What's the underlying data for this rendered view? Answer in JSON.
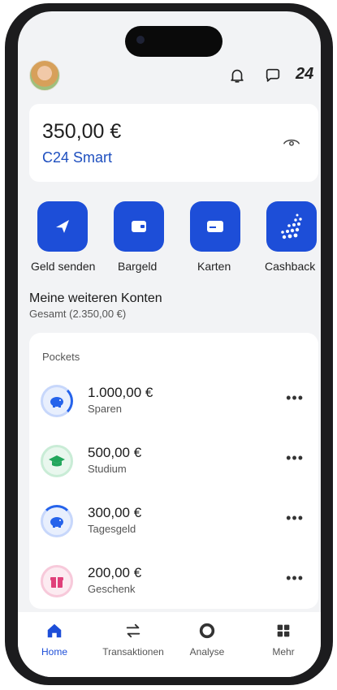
{
  "header": {
    "avatar_icon": "user-avatar",
    "bell_icon": "bell-icon",
    "chat_icon": "chat-icon",
    "brand_badge": "24"
  },
  "balance_card": {
    "amount": "350,00 €",
    "account_name": "C24 Smart",
    "visibility_icon": "eye-icon"
  },
  "actions": [
    {
      "label": "Geld senden",
      "icon": "paper-plane-icon"
    },
    {
      "label": "Bargeld",
      "icon": "wallet-icon"
    },
    {
      "label": "Karten",
      "icon": "card-icon"
    },
    {
      "label": "Cashback",
      "icon": "dots-icon"
    }
  ],
  "other_accounts": {
    "title": "Meine weiteren Konten",
    "total": "Gesamt (2.350,00 €)"
  },
  "pockets": {
    "title": "Pockets",
    "items": [
      {
        "amount": "1.000,00 €",
        "name": "Sparen",
        "icon": "piggy-bank-icon",
        "color": "#2563eb"
      },
      {
        "amount": "500,00 €",
        "name": "Studium",
        "icon": "graduation-cap-icon",
        "color": "#22a65c"
      },
      {
        "amount": "300,00 €",
        "name": "Tagesgeld",
        "icon": "piggy-bank-icon",
        "color": "#2563eb"
      },
      {
        "amount": "200,00 €",
        "name": "Geschenk",
        "icon": "gift-icon",
        "color": "#e0407a"
      }
    ],
    "menu_label": "•••"
  },
  "bottom_nav": [
    {
      "label": "Home",
      "icon": "home-icon",
      "active": true
    },
    {
      "label": "Transaktionen",
      "icon": "transfer-arrows-icon",
      "active": false
    },
    {
      "label": "Analyse",
      "icon": "donut-chart-icon",
      "active": false
    },
    {
      "label": "Mehr",
      "icon": "grid-icon",
      "active": false
    }
  ],
  "colors": {
    "accent": "#1d4ed8",
    "background": "#f2f3f5",
    "card": "#ffffff"
  }
}
